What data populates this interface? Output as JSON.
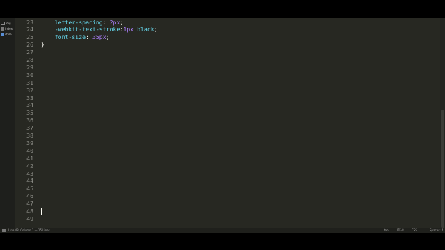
{
  "sidebar": {
    "items": [
      {
        "label": "img",
        "icon": "folder-icon"
      },
      {
        "label": "index",
        "icon": "html-file-icon"
      },
      {
        "label": "style",
        "icon": "css-file-icon"
      }
    ]
  },
  "editor": {
    "lines": [
      {
        "num": "23",
        "parts": [
          {
            "t": "    "
          },
          {
            "t": "letter-spacing",
            "c": "prop"
          },
          {
            "t": ": "
          },
          {
            "t": "2px",
            "c": "val"
          },
          {
            "t": ";"
          }
        ]
      },
      {
        "num": "24",
        "parts": [
          {
            "t": "    "
          },
          {
            "t": "-webkit-text-stroke",
            "c": "prop"
          },
          {
            "t": ":"
          },
          {
            "t": "1px",
            "c": "val"
          },
          {
            "t": " "
          },
          {
            "t": "black",
            "c": "kw"
          },
          {
            "t": ";"
          }
        ]
      },
      {
        "num": "25",
        "parts": [
          {
            "t": "    "
          },
          {
            "t": "font-size",
            "c": "prop"
          },
          {
            "t": ": "
          },
          {
            "t": "35px",
            "c": "val"
          },
          {
            "t": ";"
          }
        ]
      },
      {
        "num": "26",
        "parts": [
          {
            "t": "}"
          }
        ]
      },
      {
        "num": "27",
        "parts": []
      },
      {
        "num": "28",
        "parts": []
      },
      {
        "num": "29",
        "parts": []
      },
      {
        "num": "30",
        "parts": []
      },
      {
        "num": "31",
        "parts": []
      },
      {
        "num": "32",
        "parts": []
      },
      {
        "num": "33",
        "parts": []
      },
      {
        "num": "34",
        "parts": []
      },
      {
        "num": "35",
        "parts": []
      },
      {
        "num": "36",
        "parts": []
      },
      {
        "num": "37",
        "parts": []
      },
      {
        "num": "38",
        "parts": []
      },
      {
        "num": "39",
        "parts": []
      },
      {
        "num": "40",
        "parts": []
      },
      {
        "num": "41",
        "parts": []
      },
      {
        "num": "42",
        "parts": []
      },
      {
        "num": "43",
        "parts": []
      },
      {
        "num": "44",
        "parts": []
      },
      {
        "num": "45",
        "parts": []
      },
      {
        "num": "46",
        "parts": []
      },
      {
        "num": "47",
        "parts": []
      },
      {
        "num": "48",
        "parts": []
      },
      {
        "num": "49",
        "parts": []
      }
    ],
    "cursor_line": "48"
  },
  "status_bar": {
    "position": "Line 48, Column 1 — 15 Lines",
    "tab_size": "tab",
    "encoding": "UTF-8",
    "syntax": "CSS",
    "indentation": "Spaces: 4"
  },
  "colors": {
    "background": "#272822",
    "property": "#66d9ef",
    "value": "#ae81ff",
    "gutter_text": "#8f908a"
  }
}
